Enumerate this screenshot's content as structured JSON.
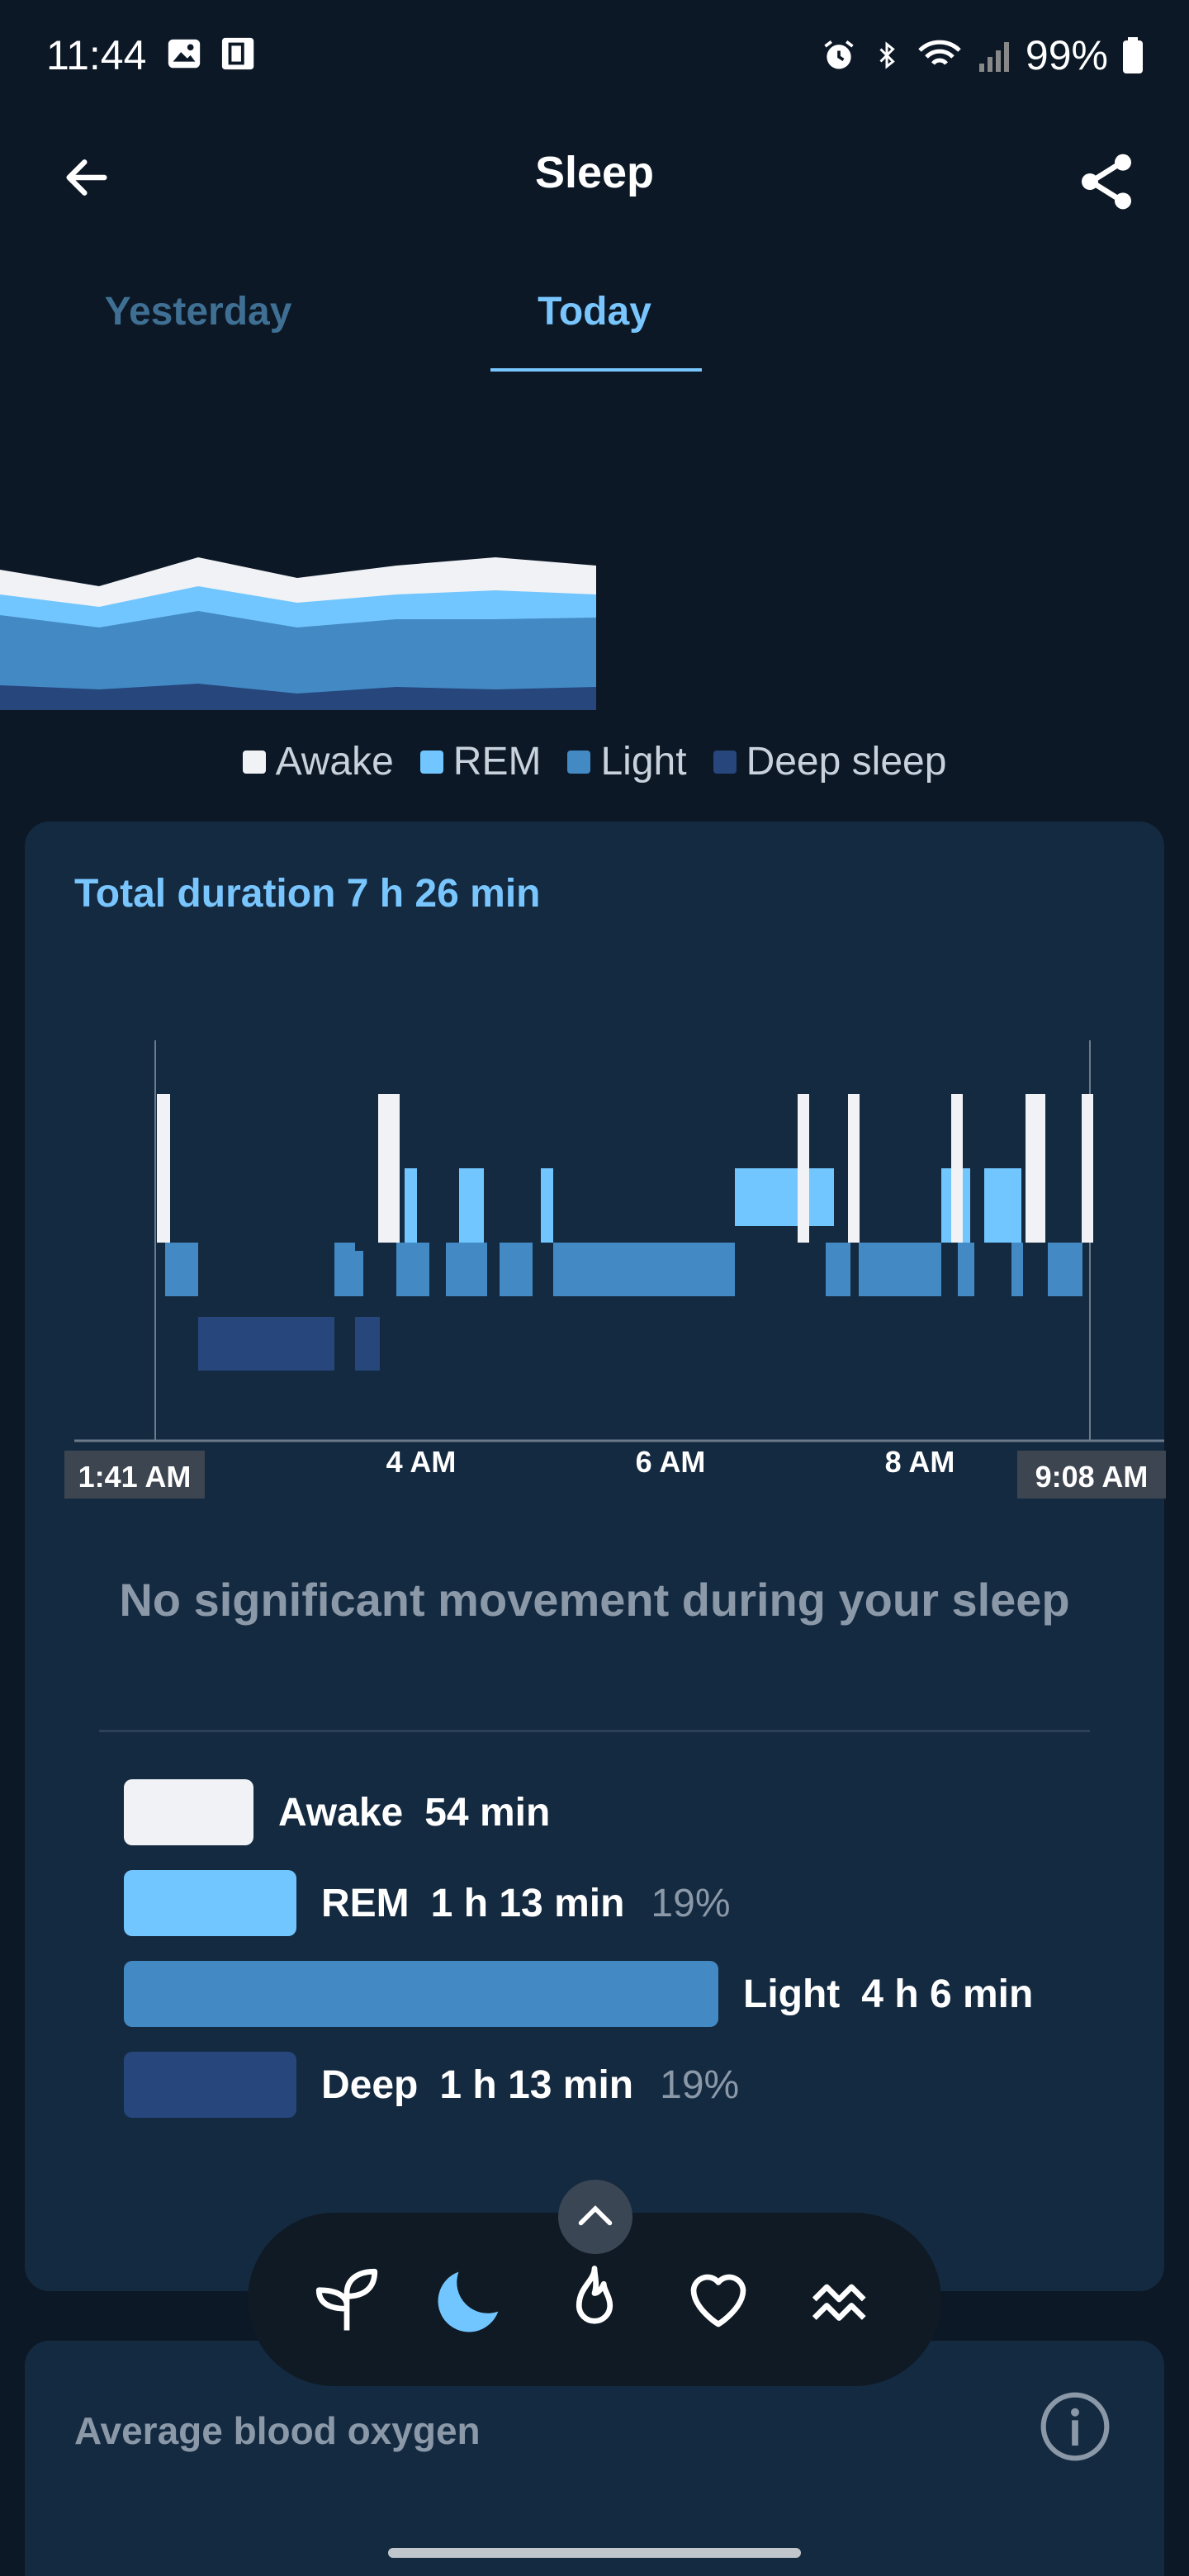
{
  "status_bar": {
    "time": "11:44",
    "battery": "99%"
  },
  "app_bar": {
    "title": "Sleep"
  },
  "tabs": [
    {
      "label": "Yesterday",
      "active": false
    },
    {
      "label": "Today",
      "active": true
    }
  ],
  "legend": [
    {
      "label": "Awake",
      "color": "#f0f2f5"
    },
    {
      "label": "REM",
      "color": "#72c6ff"
    },
    {
      "label": "Light",
      "color": "#4389c3"
    },
    {
      "label": "Deep sleep",
      "color": "#26467c"
    }
  ],
  "card": {
    "total_duration": "Total duration 7 h 26 min",
    "no_movement": "No significant movement during your sleep"
  },
  "hypnogram": {
    "start_label": "1:41 AM",
    "end_label": "9:08 AM",
    "tick_labels": [
      "4 AM",
      "6 AM",
      "8 AM"
    ]
  },
  "stages": [
    {
      "name": "Awake",
      "value": "54 min",
      "percent": "",
      "color": "#f0f2f5",
      "fraction": 0.12
    },
    {
      "name": "REM",
      "value": "1 h 13 min",
      "percent": "19%",
      "color": "#72c6ff",
      "fraction": 0.16
    },
    {
      "name": "Light",
      "value": "4 h 6 min",
      "percent": "",
      "color": "#4389c3",
      "fraction": 0.55
    },
    {
      "name": "Deep",
      "value": "1 h 13 min",
      "percent": "19%",
      "color": "#26467c",
      "fraction": 0.16
    }
  ],
  "card2": {
    "title": "Average blood oxygen"
  },
  "bottom_nav": [
    "sprout-icon",
    "moon-icon",
    "flame-icon",
    "heart-icon",
    "waves-icon"
  ]
}
